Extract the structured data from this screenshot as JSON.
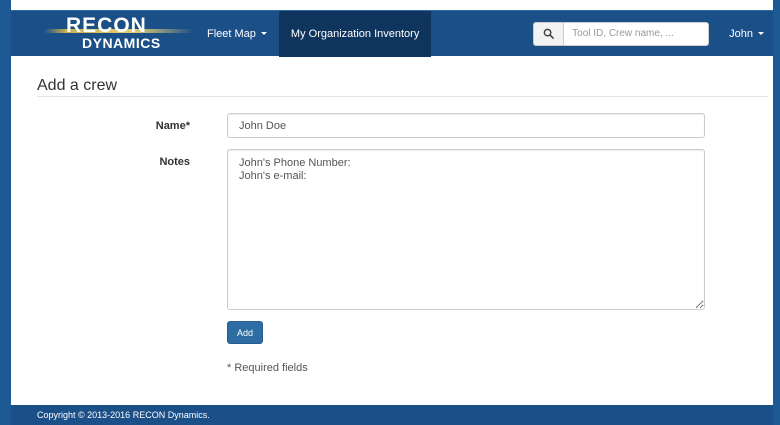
{
  "brand": {
    "line1": "RECON",
    "line2": "DYNAMICS",
    "accent_color": "#c9b24f"
  },
  "navbar": {
    "background": "#1b4f88",
    "active_background": "#0f345e",
    "fleet_map_label": "Fleet Map",
    "inventory_label": "My Organization Inventory",
    "search_icon": "search-icon",
    "search_placeholder": "Tool ID, Crew name, ...",
    "user_label": "John"
  },
  "page": {
    "title": "Add a crew"
  },
  "form": {
    "name_label": "Name*",
    "name_value": "John Doe",
    "notes_label": "Notes",
    "notes_value": "John's Phone Number:\nJohn's e-mail:",
    "submit_label": "Add",
    "submit_color": "#2e6da4",
    "required_note": "* Required fields"
  },
  "footer": {
    "copyright": "Copyright © 2013-2016 RECON Dynamics."
  }
}
